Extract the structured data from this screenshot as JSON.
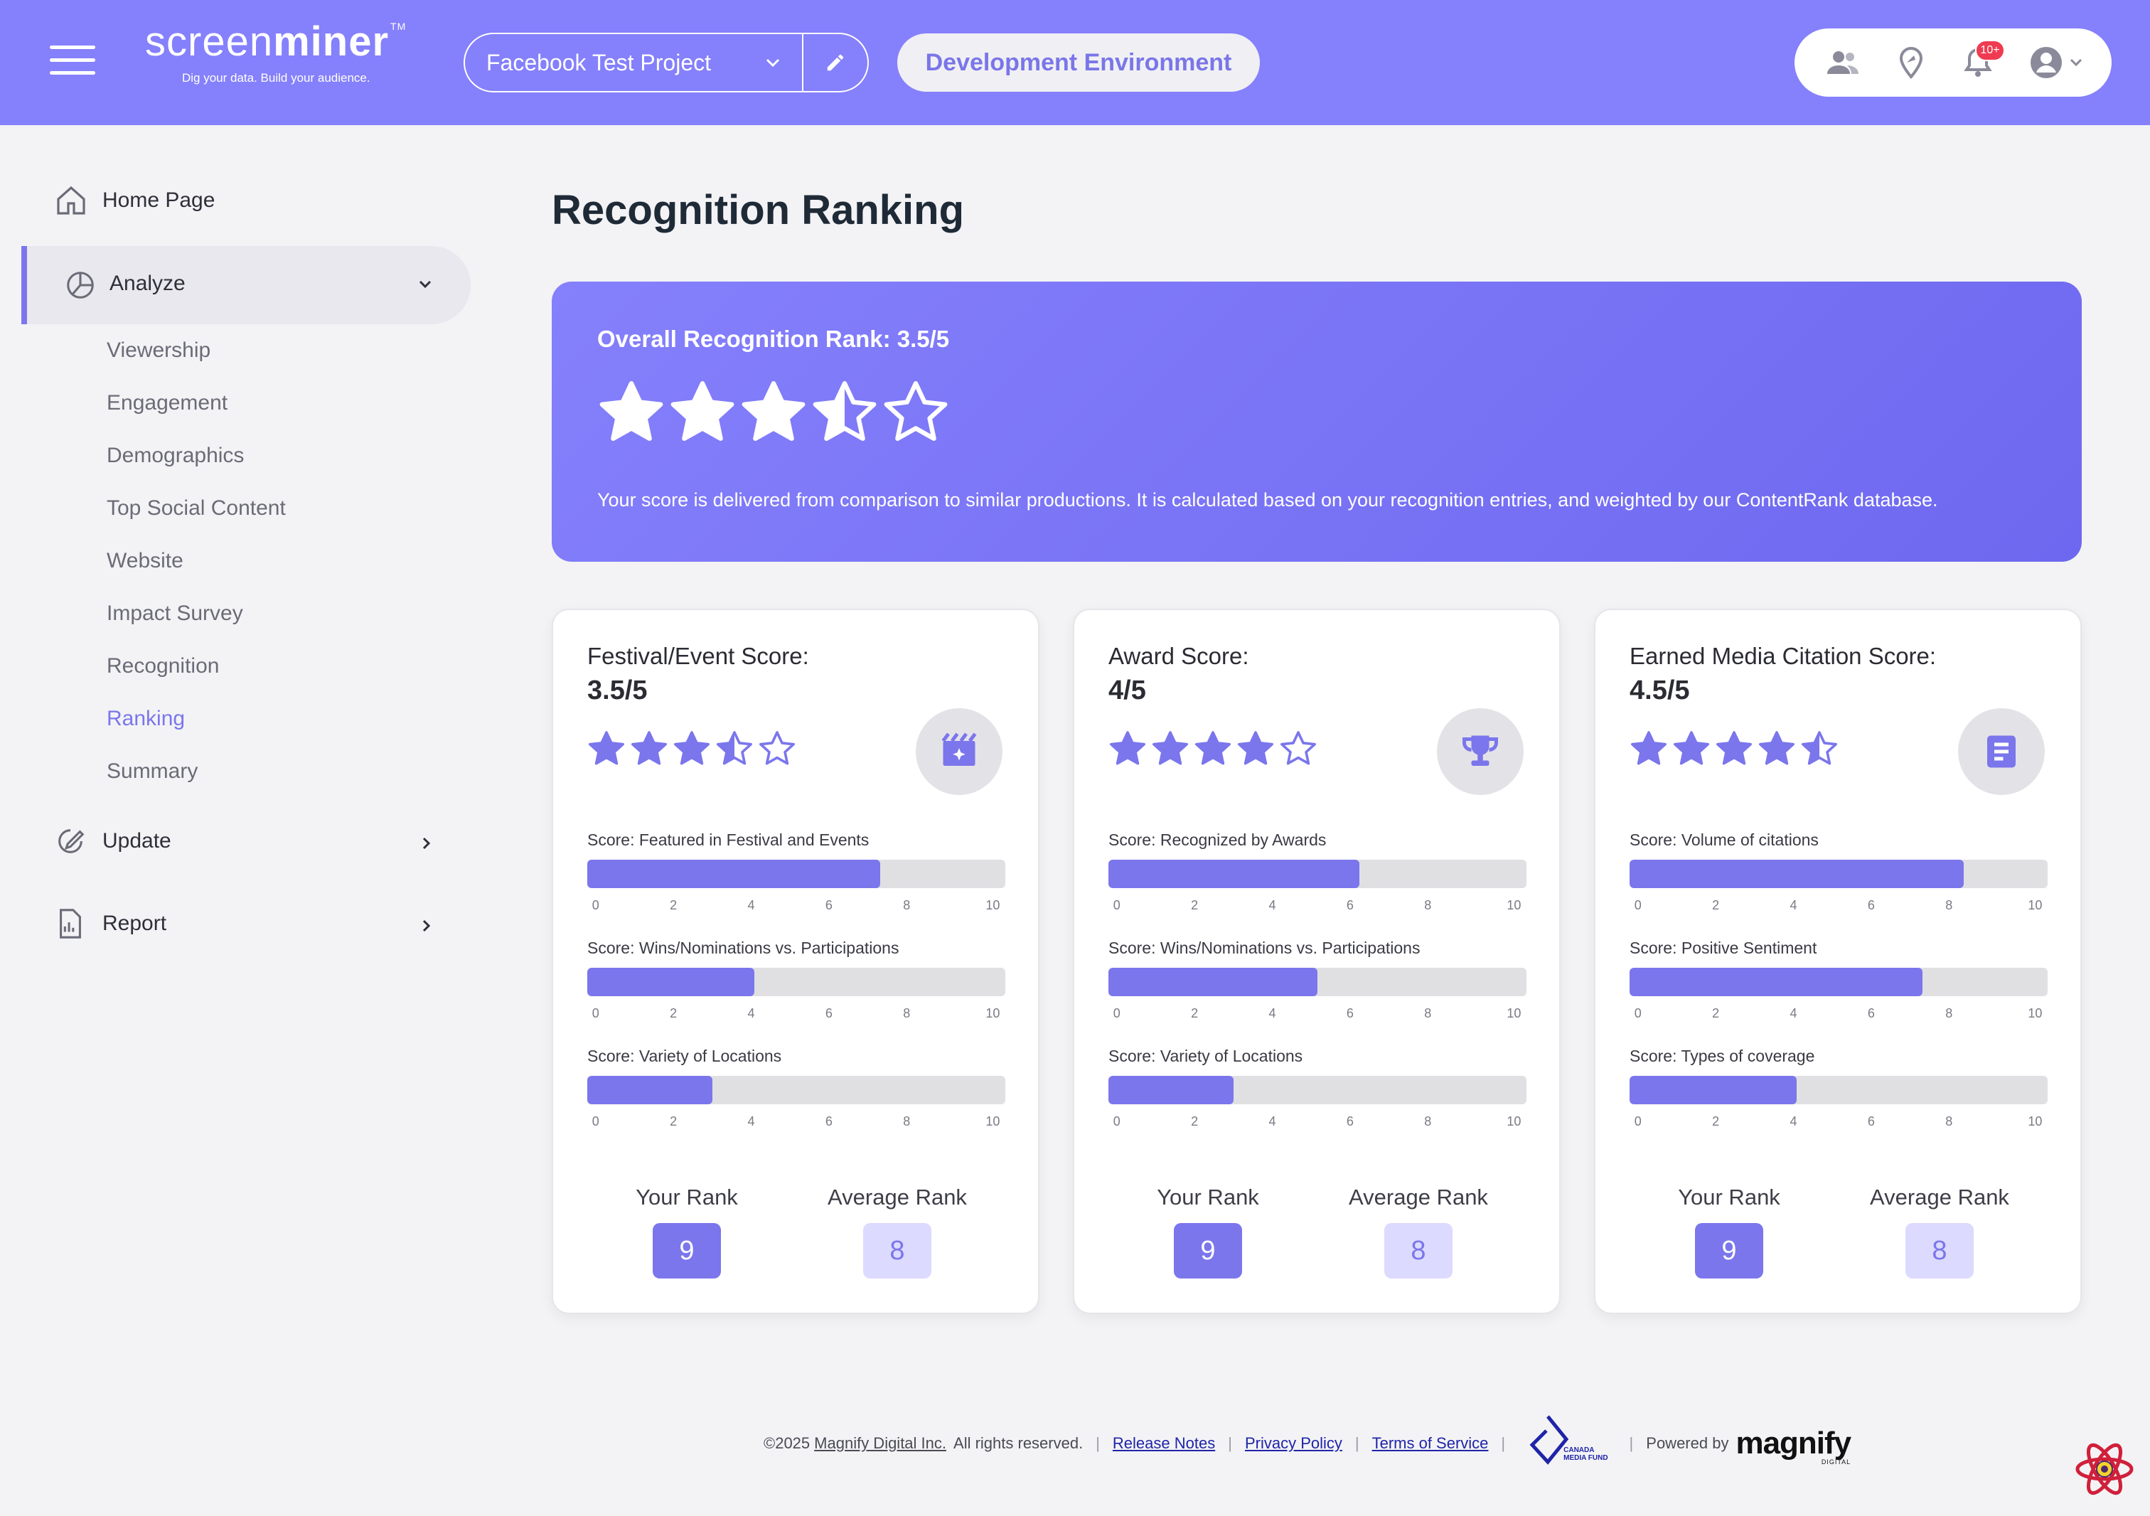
{
  "header": {
    "logo_prefix": "screen",
    "logo_suffix": "miner",
    "logo_tm": "TM",
    "tagline": "Dig your data. Build your audience.",
    "project": "Facebook Test Project",
    "environment": "Development Environment",
    "notifications_badge": "10+",
    "icons": [
      "menu-icon",
      "users-icon",
      "location-pin-icon",
      "bell-icon",
      "user-avatar-icon",
      "chevron-down-icon",
      "pencil-icon"
    ]
  },
  "sidebar": {
    "home": "Home Page",
    "analyze": "Analyze",
    "analyze_items": [
      "Viewership",
      "Engagement",
      "Demographics",
      "Top Social Content",
      "Website",
      "Impact Survey",
      "Recognition",
      "Ranking",
      "Summary"
    ],
    "active_item": "Ranking",
    "update": "Update",
    "report": "Report"
  },
  "main": {
    "title": "Recognition Ranking",
    "overall": {
      "title": "Overall Recognition Rank: 3.5/5",
      "rating": 3.5,
      "max": 5,
      "description": "Your score is delivered from comparison to similar productions. It is calculated based on your recognition entries, and weighted by our ContentRank database."
    },
    "rank_labels": {
      "yours": "Your Rank",
      "average": "Average Rank"
    },
    "scale_ticks": [
      "0",
      "2",
      "4",
      "6",
      "8",
      "10"
    ],
    "cards": [
      {
        "title": "Festival/Event Score:",
        "value": "3.5/5",
        "rating": 3.5,
        "icon": "clapperboard-icon",
        "metrics": [
          {
            "label": "Score: Featured in Festival and Events",
            "value": 7
          },
          {
            "label": "Score: Wins/Nominations vs. Participations",
            "value": 4
          },
          {
            "label": "Score: Variety of Locations",
            "value": 3
          }
        ],
        "your_rank": "9",
        "average_rank": "8"
      },
      {
        "title": "Award Score:",
        "value": "4/5",
        "rating": 4,
        "icon": "trophy-icon",
        "metrics": [
          {
            "label": "Score: Recognized by Awards",
            "value": 6
          },
          {
            "label": "Score: Wins/Nominations vs. Participations",
            "value": 5
          },
          {
            "label": "Score: Variety of Locations",
            "value": 3
          }
        ],
        "your_rank": "9",
        "average_rank": "8"
      },
      {
        "title": "Earned Media Citation Score:",
        "value": "4.5/5",
        "rating": 4.5,
        "icon": "document-icon",
        "metrics": [
          {
            "label": "Score: Volume of citations",
            "value": 8
          },
          {
            "label": "Score: Positive Sentiment",
            "value": 7
          },
          {
            "label": "Score: Types of coverage",
            "value": 4
          }
        ],
        "your_rank": "9",
        "average_rank": "8"
      }
    ]
  },
  "footer": {
    "copyright": "©2025",
    "company": "Magnify Digital Inc.",
    "rights": "All rights reserved.",
    "release_notes": "Release Notes",
    "privacy": "Privacy Policy",
    "terms": "Terms of Service",
    "cmf_line1": "CANADA",
    "cmf_line2": "MEDIA FUND",
    "powered_by": "Powered by",
    "brand": "magnify",
    "brand_sub": "DIGITAL"
  },
  "colors": {
    "accent": "#7b76ec",
    "header_bg": "#8580fb",
    "badge": "#ef3b51",
    "avg_rank_bg": "#dcdafe"
  }
}
